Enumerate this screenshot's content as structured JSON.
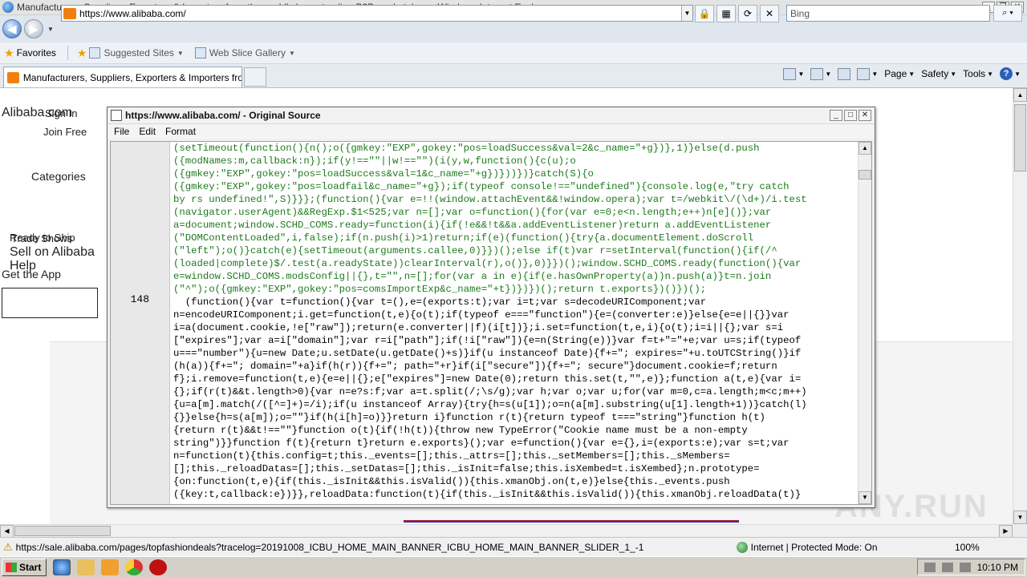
{
  "window": {
    "title": "Manufacturers, Suppliers, Exporters & Importers from the world's largest online B2B marketplace - Windows Internet Explorer"
  },
  "address_bar": {
    "url": "https://www.alibaba.com/",
    "search_placeholder": "Bing"
  },
  "favorites_bar": {
    "favorites_label": "Favorites",
    "items": [
      "Suggested Sites",
      "Web Slice Gallery"
    ]
  },
  "tab": {
    "title": "Manufacturers, Suppliers, Exporters & Importers from..."
  },
  "command_bar": {
    "page": "Page",
    "safety": "Safety",
    "tools": "Tools"
  },
  "page": {
    "logo_text": "Alibaba.com",
    "sign_in": "Sign In",
    "join_free": "Join Free",
    "categories": "Categories",
    "overlap_text": "Ready to Ship",
    "overlap_text2": "Trade Shows",
    "sell": "Sell on Alibaba",
    "help": "Help",
    "get_app": "Get the App"
  },
  "source_window": {
    "title": "https://www.alibaba.com/ - Original Source",
    "menu": [
      "File",
      "Edit",
      "Format"
    ],
    "line_number": "148",
    "code_green": [
      "(setTimeout(function(){n();o({gmkey:\"EXP\",gokey:\"pos=loadSuccess&val=2&c_name=\"+g})},1)}else(d.push",
      "({modNames:m,callback:n});if(y!==\"\"||w!==\"\")(i(y,w,function(){c(u);o",
      "({gmkey:\"EXP\",gokey:\"pos=loadSuccess&val=1&c_name=\"+g})}))})}catch(S){o",
      "({gmkey:\"EXP\",gokey:\"pos=loadfail&c_name=\"+g});if(typeof console!==\"undefined\"){console.log(e,\"try catch",
      "by rs undefined!\",S)}}};(function(){var e=!!(window.attachEvent&&!window.opera);var t=/webkit\\/(\\d+)/i.test",
      "(navigator.userAgent)&&RegExp.$1<525;var n=[];var o=function(){for(var e=0;e<n.length;e++)n[e]()};var",
      "a=document;window.SCHD_COMS.ready=function(i){if(!e&&!t&&a.addEventListener)return a.addEventListener",
      "(\"DOMContentLoaded\",i,false);if(n.push(i)>1)return;if(e)(function(){try{a.documentElement.doScroll",
      "(\"left\");o()}catch(e){setTimeout(arguments.callee,0)}})();else if(t)var r=setInterval(function(){if(/^",
      "(loaded|complete)$/.test(a.readyState))clearInterval(r),o()},0)}})();window.SCHD_COMS.ready(function(){var",
      "e=window.SCHD_COMS.modsConfig||{},t=\"\",n=[];for(var a in e){if(e.hasOwnProperty(a))n.push(a)}t=n.join",
      "(\"^\");o({gmkey:\"EXP\",gokey:\"pos=comsImportExp&c_name=\"+t})})})();return t.exports})()})();"
    ],
    "code_black": [
      "  (function(){var t=function(){var t=(),e=(exports:t);var i=t;var s=decodeURIComponent;var",
      "n=encodeURIComponent;i.get=function(t,e){o(t);if(typeof e===\"function\"){e=(converter:e)}else{e=e||{}}var",
      "i=a(document.cookie,!e[\"raw\"]);return(e.converter||f)(i[t])};i.set=function(t,e,i){o(t);i=i||{};var s=i",
      "[\"expires\"];var a=i[\"domain\"];var r=i[\"path\"];if(!i[\"raw\"]){e=n(String(e))}var f=t+\"=\"+e;var u=s;if(typeof",
      "u===\"number\"){u=new Date;u.setDate(u.getDate()+s)}if(u instanceof Date){f+=\"; expires=\"+u.toUTCString()}if",
      "(h(a)){f+=\"; domain=\"+a}if(h(r)){f+=\"; path=\"+r}if(i[\"secure\"]){f+=\"; secure\"}document.cookie=f;return",
      "f};i.remove=function(t,e){e=e||{};e[\"expires\"]=new Date(0);return this.set(t,\"\",e)};function a(t,e){var i=",
      "{};if(r(t)&&t.length>0){var n=e?s:f;var a=t.split(/;\\s/g);var h;var o;var u;for(var m=0,c=a.length;m<c;m++)",
      "{u=a[m].match(/([^=]+)=/i);if(u instanceof Array){try{h=s(u[1]);o=n(a[m].substring(u[1].length+1))}catch(l)",
      "{}}else{h=s(a[m]);o=\"\"}if(h(i[h]=o)}}return i}function r(t){return typeof t===\"string\"}function h(t)",
      "{return r(t)&&t!==\"\"}function o(t){if(!h(t)){throw new TypeError(\"Cookie name must be a non-empty",
      "string\")}}function f(t){return t}return e.exports}();var e=function(){var e={},i=(exports:e);var s=t;var",
      "n=function(t){this.config=t;this._events=[];this._attrs=[];this._setMembers=[];this._sMembers=",
      "[];this._reloadDatas=[];this._setDatas=[];this._isInit=false;this.isXembed=t.isXembed};n.prototype=",
      "{on:function(t,e){if(this._isInit&&this.isValid()){this.xmanObj.on(t,e)}else{this._events.push",
      "({key:t,callback:e})}},reloadData:function(t){if(this._isInit&&this.isValid()){this.xmanObj.reloadData(t)}"
    ]
  },
  "status_bar": {
    "url": "https://sale.alibaba.com/pages/topfashiondeals?tracelog=20191008_ICBU_HOME_MAIN_BANNER_ICBU_HOME_MAIN_BANNER_SLIDER_1_-1",
    "zone": "Internet | Protected Mode: On",
    "zoom": "100%"
  },
  "taskbar": {
    "start": "Start",
    "clock": "10:10 PM"
  },
  "watermark": "ANY.RUN"
}
